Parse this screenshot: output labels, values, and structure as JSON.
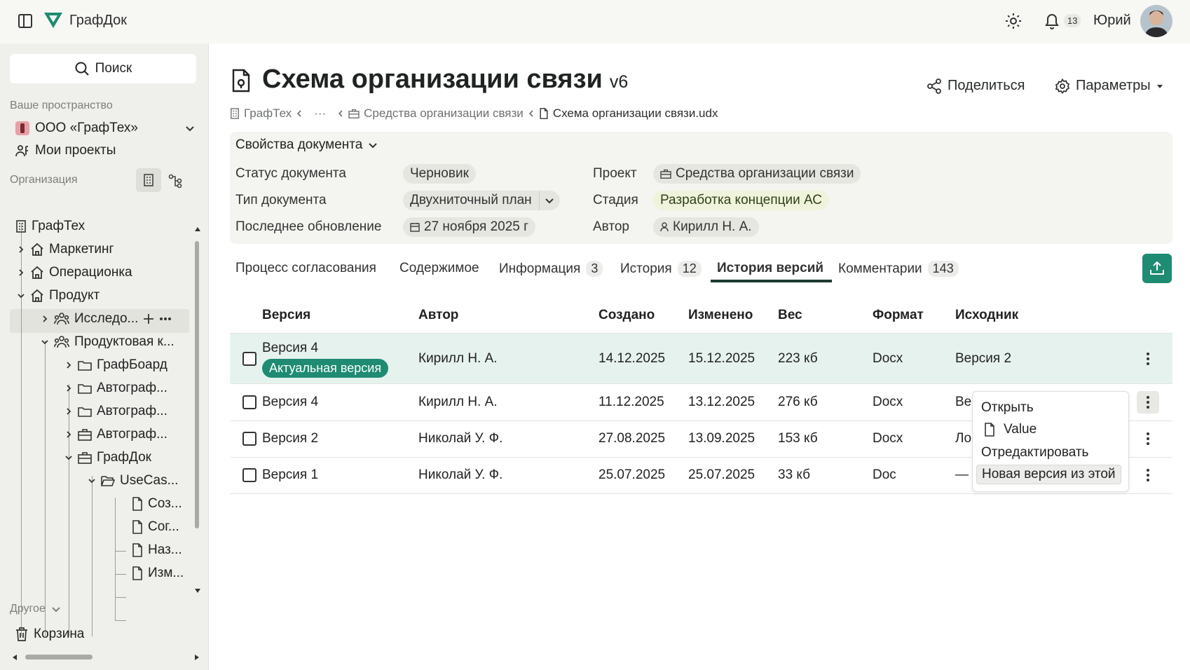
{
  "app": {
    "name": "ГрафДок"
  },
  "header": {
    "notifications": "13",
    "user": "Юрий"
  },
  "sidebar": {
    "search": "Поиск",
    "space_label": "Ваше пространство",
    "org_name": "ООО «ГрафТех»",
    "my_projects": "Мои проекты",
    "org_section": "Организация",
    "tree": {
      "root": "ГрафТех",
      "marketing": "Маркетинг",
      "operations": "Операционка",
      "product": "Продукт",
      "research": "Исследо...",
      "product_team": "Продуктовая к...",
      "grafboard": "ГрафБоард",
      "autograf1": "Автограф...",
      "autograf2": "Автограф...",
      "autograf3": "Автограф...",
      "grafdoc": "ГрафДок",
      "usecases": "UseCas...",
      "doc1": "Соз...",
      "doc2": "Сог...",
      "doc3": "Наз...",
      "doc4": "Изм..."
    },
    "other_label": "Другое",
    "trash": "Корзина"
  },
  "document": {
    "title": "Схема организации связи",
    "version": "v6",
    "share": "Поделиться",
    "params": "Параметры",
    "breadcrumb": {
      "root": "ГрафТех",
      "ellipsis": "···",
      "folder": "Средства организации связи",
      "file": "Схема организации связи.udx"
    }
  },
  "props": {
    "header": "Свойства документа",
    "status_label": "Статус документа",
    "status": "Черновик",
    "type_label": "Тип документа",
    "type": "Двухниточный план",
    "updated_label": "Последнее обновление",
    "updated": "27 ноября 2025 г",
    "project_label": "Проект",
    "project": "Средства организации связи",
    "stage_label": "Стадия",
    "stage": "Разработка концепции АС",
    "author_label": "Автор",
    "author": "Кирилл Н. А."
  },
  "tabs": [
    {
      "label": "Процесс согласования",
      "count": ""
    },
    {
      "label": "Содержимое",
      "count": ""
    },
    {
      "label": "Информация",
      "count": "3"
    },
    {
      "label": "История",
      "count": "12"
    },
    {
      "label": "История версий",
      "count": ""
    },
    {
      "label": "Комментарии",
      "count": "143"
    }
  ],
  "table": {
    "headers": [
      "Версия",
      "Автор",
      "Создано",
      "Изменено",
      "Вес",
      "Формат",
      "Исходник"
    ],
    "actual_badge": "Актуальная версия",
    "rows": [
      [
        "Версия 4",
        "Кирилл Н. А.",
        "14.12.2025",
        "15.12.2025",
        "223 кб",
        "Docx",
        "Версия 2"
      ],
      [
        "Версия 4",
        "Кирилл Н. А.",
        "11.12.2025",
        "13.12.2025",
        "276 кб",
        "Docx",
        "Ве"
      ],
      [
        "Версия 2",
        "Николай У. Ф.",
        "27.08.2025",
        "13.09.2025",
        "153 кб",
        "Docx",
        "Ло"
      ],
      [
        "Версия 1",
        "Николай У. Ф.",
        "25.07.2025",
        "25.07.2025",
        "33 кб",
        "Doc",
        "—"
      ]
    ]
  },
  "context_menu": [
    "Открыть",
    "Value",
    "Отредактировать",
    "Новая версия из этой"
  ],
  "colors": {
    "accent": "#1e8b72",
    "tab_underline": "#1e3b2e",
    "selected_row": "#e6f2ee"
  }
}
